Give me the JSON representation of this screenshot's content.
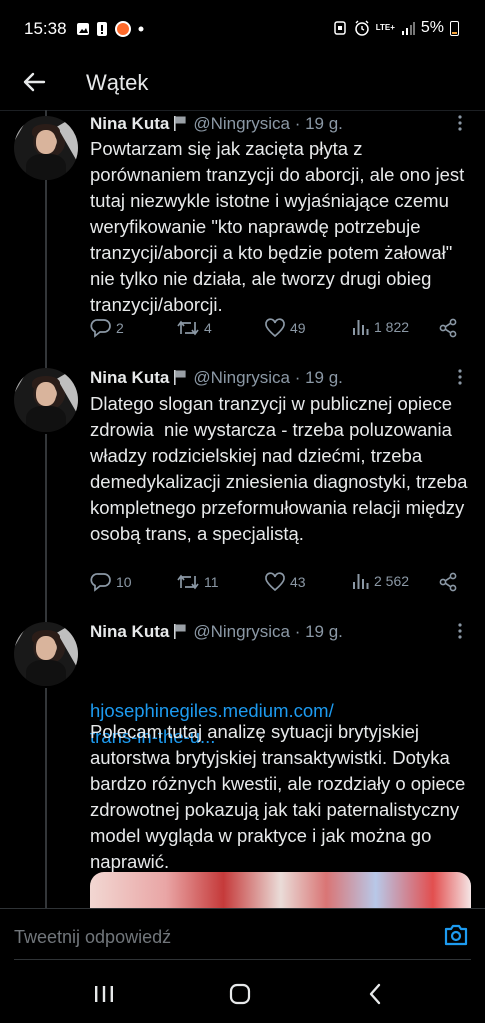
{
  "status_bar": {
    "time": "15:38",
    "network": "LTE+",
    "battery": "5%"
  },
  "header": {
    "title": "Wątek"
  },
  "tweets": [
    {
      "name": "Nina Kuta",
      "handle": "@Ningrysica",
      "time": "· 19 g.",
      "text": "Powtarzam się jak zacięta płyta z porównaniem tranzycji do aborcji, ale ono jest tutaj niezwykle istotne i wyjaśniające czemu weryfikowanie \"kto naprawdę potrzebuje tranzycji/aborcji a kto będzie potem żałował\" nie tylko nie działa, ale tworzy drugi obieg tranzycji/aborcji.",
      "replies": "2",
      "retweets": "4",
      "likes": "49",
      "views": "1 822"
    },
    {
      "name": "Nina Kuta",
      "handle": "@Ningrysica",
      "time": "· 19 g.",
      "text": "Dlatego slogan tranzycji w publicznej opiece zdrowia  nie wystarcza - trzeba poluzowania władzy rodzicielskiej nad dziećmi, trzeba demedykalizacji zniesienia diagnostyki, trzeba kompletnego przeformułowania relacji między osobą trans, a specjalistą.",
      "replies": "10",
      "retweets": "11",
      "likes": "43",
      "views": "2 562"
    },
    {
      "name": "Nina Kuta",
      "handle": "@Ningrysica",
      "time": "· 19 g.",
      "link_line1": "hjosephinegiles.medium.com/",
      "link_line2": "trans-in-the-u...",
      "text": "Polecam tutaj analizę sytuacji brytyjskiej autorstwa brytyjskiej transaktywistki. Dotyka bardzo różnych kwestii, ale rozdziały o opiece zdrowotnej pokazują jak taki paternalistyczny model wygląda w praktyce i jak można go naprawić."
    }
  ],
  "reply": {
    "placeholder": "Tweetnij odpowiedź"
  },
  "colors": {
    "background": "#000000",
    "text": "#e7e9ea",
    "secondary": "#8b98a5",
    "link": "#1d9bf0"
  }
}
